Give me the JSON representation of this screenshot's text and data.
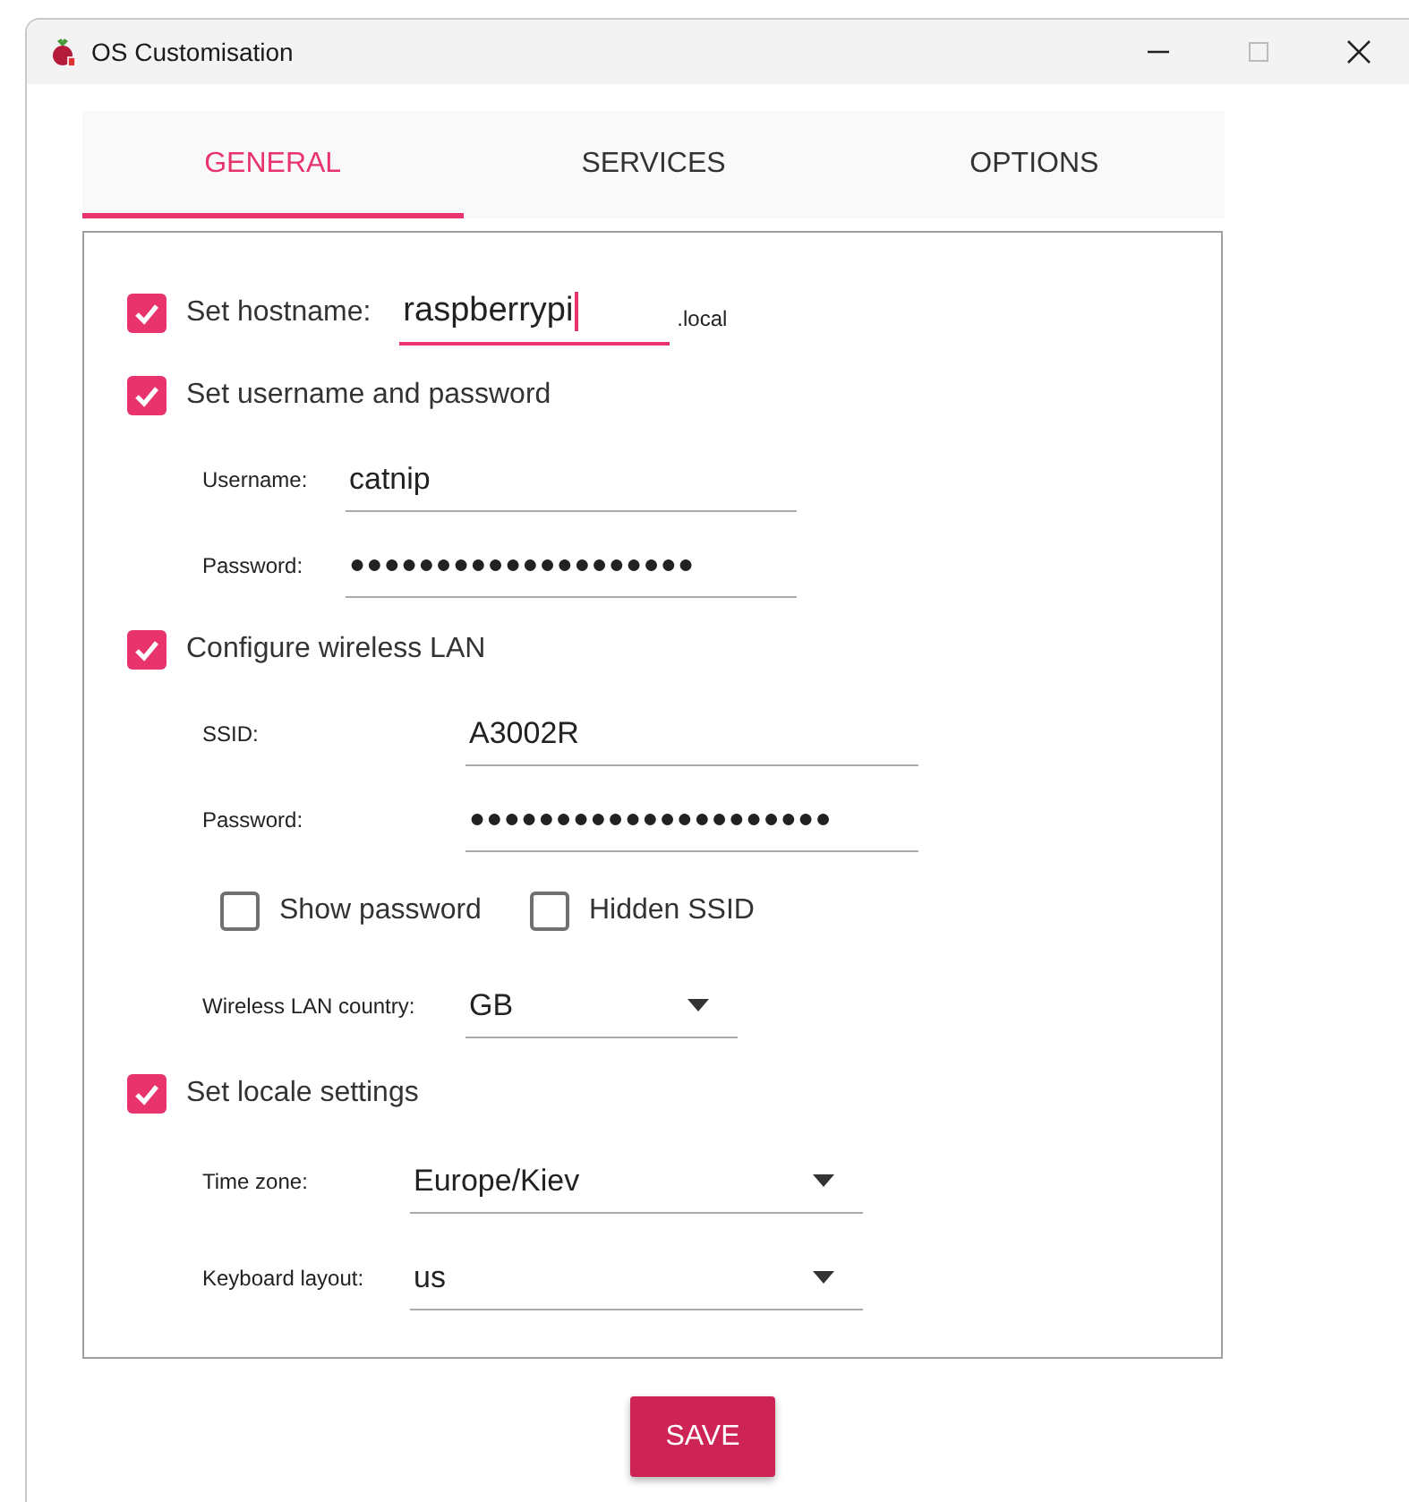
{
  "window": {
    "title": "OS Customisation"
  },
  "tabs": [
    {
      "label": "GENERAL",
      "selected": true
    },
    {
      "label": "SERVICES",
      "selected": false
    },
    {
      "label": "OPTIONS",
      "selected": false
    }
  ],
  "general": {
    "hostname": {
      "label": "Set hostname:",
      "checked": true,
      "value": "raspberrypi",
      "focused": true,
      "suffix": ".local"
    },
    "user": {
      "label": "Set username and password",
      "checked": true,
      "fields": [
        {
          "kind": "text",
          "label": "Username:",
          "value": "catnip"
        },
        {
          "kind": "password",
          "label": "Password:",
          "value": "●●●●●●●●●●●●●●●●●●●●"
        }
      ]
    },
    "wireless": {
      "label": "Configure wireless LAN",
      "checked": true,
      "fields": [
        {
          "kind": "text",
          "label": "SSID:",
          "value": "A3002R"
        },
        {
          "kind": "password",
          "label": "Password:",
          "value": "●●●●●●●●●●●●●●●●●●●●●"
        }
      ],
      "options": [
        {
          "label": "Show password",
          "checked": false
        },
        {
          "label": "Hidden SSID",
          "checked": false
        }
      ],
      "country": {
        "kind": "select",
        "label": "Wireless LAN country:",
        "value": "GB"
      }
    },
    "locale": {
      "label": "Set locale settings",
      "checked": true,
      "fields": [
        {
          "kind": "select",
          "label": "Time zone:",
          "value": "Europe/Kiev"
        },
        {
          "kind": "select",
          "label": "Keyboard layout:",
          "value": "us"
        }
      ]
    }
  },
  "save_button": "SAVE"
}
